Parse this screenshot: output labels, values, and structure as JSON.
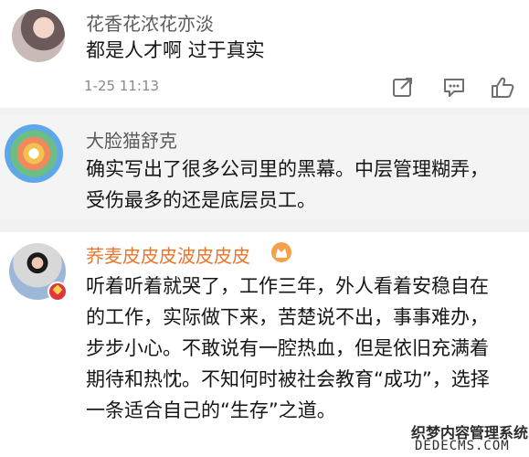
{
  "comments": [
    {
      "user": "花香花浓花亦淡",
      "text": "都是人才啊 过于真实",
      "time": "1-25 11:13",
      "avatar_icon": "avatar-photo"
    },
    {
      "user": "大脸猫舒克",
      "text": "确实写出了很多公司里的黑幕。中层管理糊弄，受伤最多的还是底层员工。",
      "avatar_icon": "avatar-cartoon"
    },
    {
      "user": "荞麦皮皮皮波皮皮皮",
      "text": "听着听着就哭了，工作三年，外人看着安稳自在的工作，实际做下来，苦楚说不出，事事难办，步步小心。不敢说有一腔热血，但是依旧充满着期待和热忱。不知何时被社会教育“成功”，选择一条适合自己的“生存”之道。",
      "avatar_icon": "avatar-photo",
      "badge_icon": "vip-crown-icon",
      "verify_icon": "verified-badge-icon"
    }
  ],
  "actions": [
    "share-icon",
    "comment-icon",
    "like-icon"
  ],
  "watermark": {
    "line1": "织梦内容管理系统",
    "line2": "DEDECMS.COM"
  }
}
